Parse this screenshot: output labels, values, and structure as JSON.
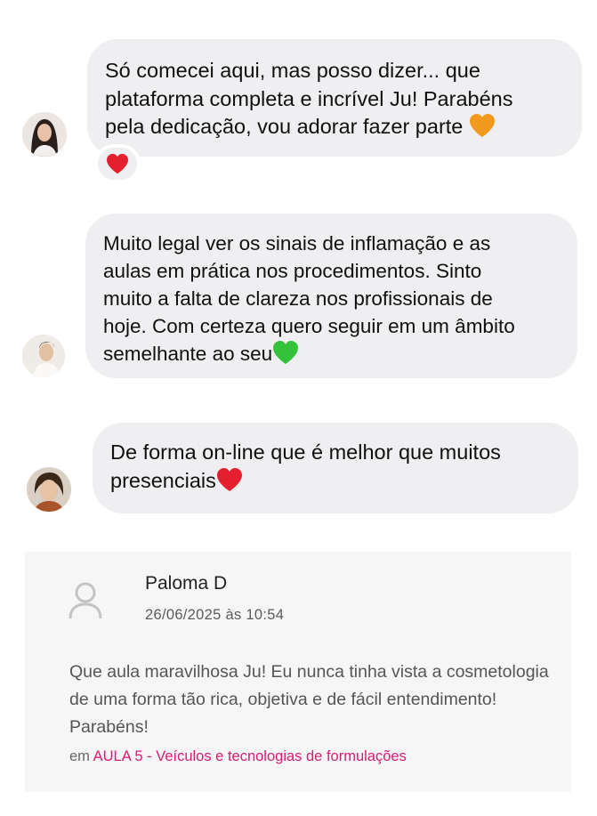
{
  "messages": [
    {
      "text": "Só comecei aqui, mas posso dizer... que\nplataforma completa e incrível Ju! Parabéns\npela dedicação, vou adorar fazer parte",
      "trailing_emoji": "orange-heart-icon",
      "reaction": "red-heart-icon"
    },
    {
      "text": "Muito legal ver os sinais de inflamação e as\naulas em prática nos procedimentos. Sinto\nmuito a falta de clareza nos profissionais de\nhoje. Com certeza quero seguir em um âmbito\nsemelhante ao seu",
      "trailing_emoji": "green-heart-icon"
    },
    {
      "text": "De forma on-line que é melhor que muitos\npresenciais",
      "trailing_emoji": "red-heart-icon"
    }
  ],
  "comment": {
    "author": "Paloma D",
    "date": "26/06/2025 às 10:54",
    "text": "Que aula maravilhosa Ju! Eu nunca tinha vista a cosmetologia de uma forma tão rica, objetiva e de fácil entendimento! Parabéns!",
    "lesson_prefix": "em",
    "lesson_link": "AULA 5 - Veículos e tecnologias de formulações"
  },
  "colors": {
    "bubble": "#efeff1",
    "card": "#f6f6f7",
    "link": "#d81b73",
    "orange_heart": "#f39a1e",
    "green_heart": "#34c23a",
    "red_heart": "#e5202e"
  }
}
